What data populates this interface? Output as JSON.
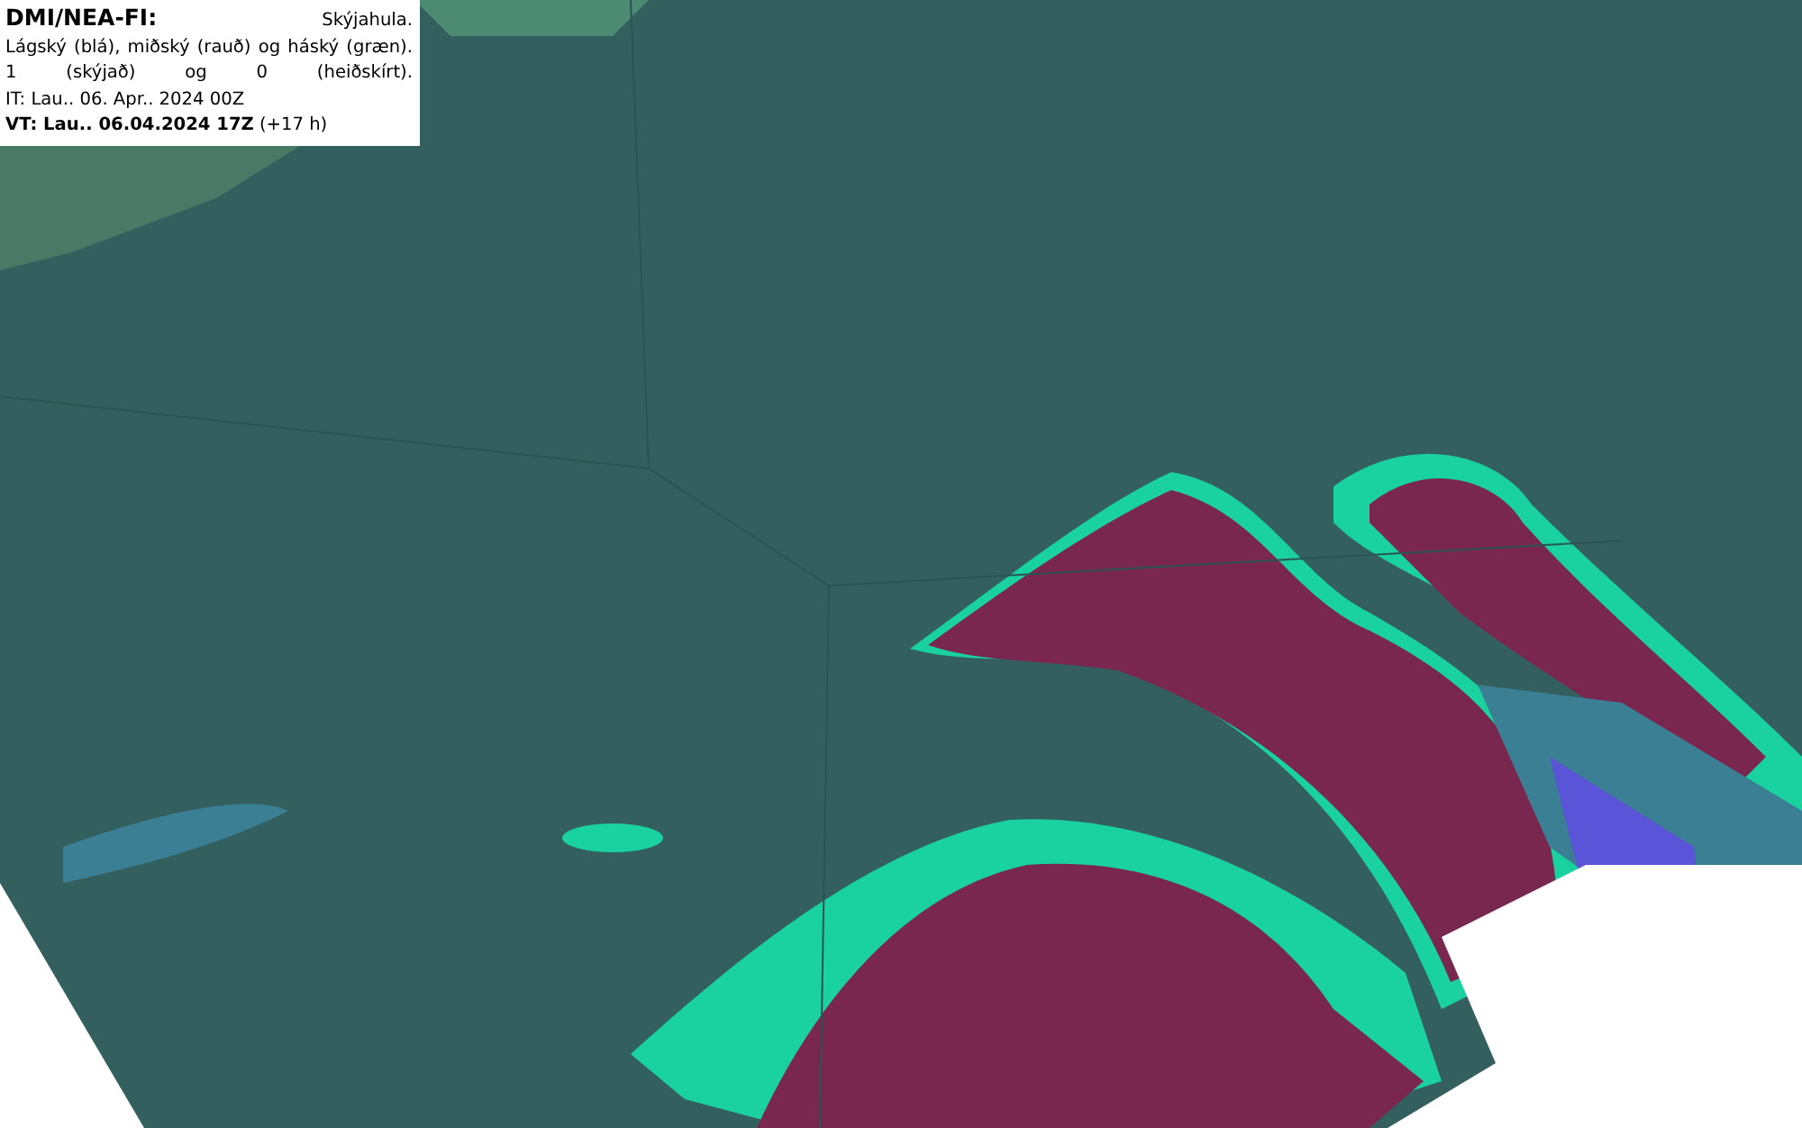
{
  "legend": {
    "source": "DMI/NEA-FI:",
    "variable": "Skýjahula.",
    "description": "Lágský (blá), miðský (rauð) og háský (græn).",
    "scale": "1 (skýjað) og 0 (heiðskírt).",
    "initial_time": "IT: Lau.. 06. Apr.. 2024 00Z",
    "valid_time": "**VT: Lau.. 06.04.2024 17Z** (+17 h)"
  }
}
